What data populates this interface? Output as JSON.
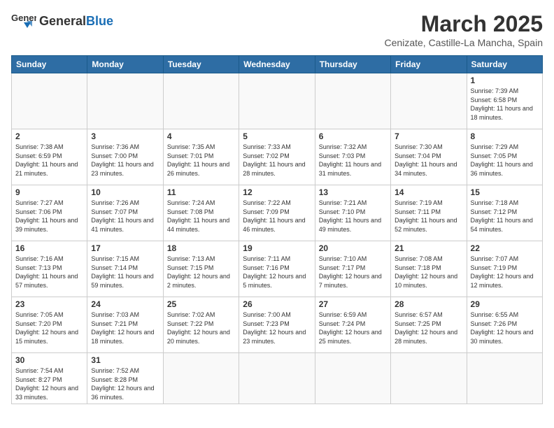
{
  "logo": {
    "text_general": "General",
    "text_blue": "Blue"
  },
  "title": "March 2025",
  "subtitle": "Cenizate, Castille-La Mancha, Spain",
  "days_of_week": [
    "Sunday",
    "Monday",
    "Tuesday",
    "Wednesday",
    "Thursday",
    "Friday",
    "Saturday"
  ],
  "weeks": [
    [
      {
        "day": "",
        "info": ""
      },
      {
        "day": "",
        "info": ""
      },
      {
        "day": "",
        "info": ""
      },
      {
        "day": "",
        "info": ""
      },
      {
        "day": "",
        "info": ""
      },
      {
        "day": "",
        "info": ""
      },
      {
        "day": "1",
        "info": "Sunrise: 7:39 AM\nSunset: 6:58 PM\nDaylight: 11 hours and 18 minutes."
      }
    ],
    [
      {
        "day": "2",
        "info": "Sunrise: 7:38 AM\nSunset: 6:59 PM\nDaylight: 11 hours and 21 minutes."
      },
      {
        "day": "3",
        "info": "Sunrise: 7:36 AM\nSunset: 7:00 PM\nDaylight: 11 hours and 23 minutes."
      },
      {
        "day": "4",
        "info": "Sunrise: 7:35 AM\nSunset: 7:01 PM\nDaylight: 11 hours and 26 minutes."
      },
      {
        "day": "5",
        "info": "Sunrise: 7:33 AM\nSunset: 7:02 PM\nDaylight: 11 hours and 28 minutes."
      },
      {
        "day": "6",
        "info": "Sunrise: 7:32 AM\nSunset: 7:03 PM\nDaylight: 11 hours and 31 minutes."
      },
      {
        "day": "7",
        "info": "Sunrise: 7:30 AM\nSunset: 7:04 PM\nDaylight: 11 hours and 34 minutes."
      },
      {
        "day": "8",
        "info": "Sunrise: 7:29 AM\nSunset: 7:05 PM\nDaylight: 11 hours and 36 minutes."
      }
    ],
    [
      {
        "day": "9",
        "info": "Sunrise: 7:27 AM\nSunset: 7:06 PM\nDaylight: 11 hours and 39 minutes."
      },
      {
        "day": "10",
        "info": "Sunrise: 7:26 AM\nSunset: 7:07 PM\nDaylight: 11 hours and 41 minutes."
      },
      {
        "day": "11",
        "info": "Sunrise: 7:24 AM\nSunset: 7:08 PM\nDaylight: 11 hours and 44 minutes."
      },
      {
        "day": "12",
        "info": "Sunrise: 7:22 AM\nSunset: 7:09 PM\nDaylight: 11 hours and 46 minutes."
      },
      {
        "day": "13",
        "info": "Sunrise: 7:21 AM\nSunset: 7:10 PM\nDaylight: 11 hours and 49 minutes."
      },
      {
        "day": "14",
        "info": "Sunrise: 7:19 AM\nSunset: 7:11 PM\nDaylight: 11 hours and 52 minutes."
      },
      {
        "day": "15",
        "info": "Sunrise: 7:18 AM\nSunset: 7:12 PM\nDaylight: 11 hours and 54 minutes."
      }
    ],
    [
      {
        "day": "16",
        "info": "Sunrise: 7:16 AM\nSunset: 7:13 PM\nDaylight: 11 hours and 57 minutes."
      },
      {
        "day": "17",
        "info": "Sunrise: 7:15 AM\nSunset: 7:14 PM\nDaylight: 11 hours and 59 minutes."
      },
      {
        "day": "18",
        "info": "Sunrise: 7:13 AM\nSunset: 7:15 PM\nDaylight: 12 hours and 2 minutes."
      },
      {
        "day": "19",
        "info": "Sunrise: 7:11 AM\nSunset: 7:16 PM\nDaylight: 12 hours and 5 minutes."
      },
      {
        "day": "20",
        "info": "Sunrise: 7:10 AM\nSunset: 7:17 PM\nDaylight: 12 hours and 7 minutes."
      },
      {
        "day": "21",
        "info": "Sunrise: 7:08 AM\nSunset: 7:18 PM\nDaylight: 12 hours and 10 minutes."
      },
      {
        "day": "22",
        "info": "Sunrise: 7:07 AM\nSunset: 7:19 PM\nDaylight: 12 hours and 12 minutes."
      }
    ],
    [
      {
        "day": "23",
        "info": "Sunrise: 7:05 AM\nSunset: 7:20 PM\nDaylight: 12 hours and 15 minutes."
      },
      {
        "day": "24",
        "info": "Sunrise: 7:03 AM\nSunset: 7:21 PM\nDaylight: 12 hours and 18 minutes."
      },
      {
        "day": "25",
        "info": "Sunrise: 7:02 AM\nSunset: 7:22 PM\nDaylight: 12 hours and 20 minutes."
      },
      {
        "day": "26",
        "info": "Sunrise: 7:00 AM\nSunset: 7:23 PM\nDaylight: 12 hours and 23 minutes."
      },
      {
        "day": "27",
        "info": "Sunrise: 6:59 AM\nSunset: 7:24 PM\nDaylight: 12 hours and 25 minutes."
      },
      {
        "day": "28",
        "info": "Sunrise: 6:57 AM\nSunset: 7:25 PM\nDaylight: 12 hours and 28 minutes."
      },
      {
        "day": "29",
        "info": "Sunrise: 6:55 AM\nSunset: 7:26 PM\nDaylight: 12 hours and 30 minutes."
      }
    ],
    [
      {
        "day": "30",
        "info": "Sunrise: 7:54 AM\nSunset: 8:27 PM\nDaylight: 12 hours and 33 minutes."
      },
      {
        "day": "31",
        "info": "Sunrise: 7:52 AM\nSunset: 8:28 PM\nDaylight: 12 hours and 36 minutes."
      },
      {
        "day": "",
        "info": ""
      },
      {
        "day": "",
        "info": ""
      },
      {
        "day": "",
        "info": ""
      },
      {
        "day": "",
        "info": ""
      },
      {
        "day": "",
        "info": ""
      }
    ]
  ]
}
